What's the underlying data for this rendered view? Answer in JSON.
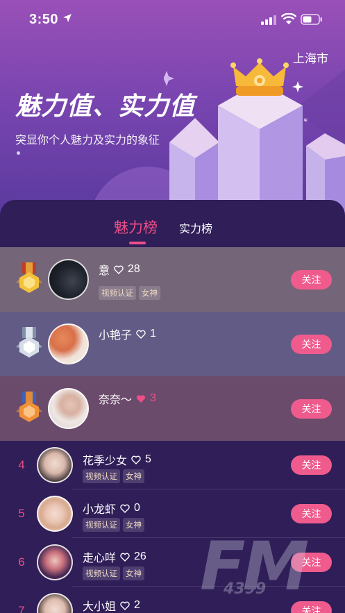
{
  "status": {
    "time": "3:50"
  },
  "header": {
    "city": "上海市",
    "title": "魅力值、实力值",
    "subtitle": "突显你个人魅力及实力的象征"
  },
  "tabs": [
    {
      "label": "魅力榜",
      "active": true
    },
    {
      "label": "实力榜",
      "active": false
    }
  ],
  "top3": [
    {
      "rank": 1,
      "medal": "gold-medal-icon",
      "name": "意",
      "likes": "28",
      "tags": [
        "视频认证",
        "女神"
      ],
      "follow": "关注"
    },
    {
      "rank": 2,
      "medal": "silver-medal-icon",
      "name": "小艳子",
      "likes": "1",
      "tags": [],
      "follow": "关注"
    },
    {
      "rank": 3,
      "medal": "bronze-medal-icon",
      "name": "奈奈～",
      "likes": "3",
      "tags": [],
      "follow": "关注"
    }
  ],
  "list": [
    {
      "rank": "4",
      "name": "花季少女",
      "likes": "5",
      "tags": [
        "视频认证",
        "女神"
      ],
      "follow": "关注"
    },
    {
      "rank": "5",
      "name": "小龙虾",
      "likes": "0",
      "tags": [
        "视频认证",
        "女神"
      ],
      "follow": "关注"
    },
    {
      "rank": "6",
      "name": "走心咩",
      "likes": "26",
      "tags": [
        "视频认证",
        "女神"
      ],
      "follow": "关注"
    },
    {
      "rank": "7",
      "name": "大小姐",
      "likes": "2",
      "tags": [],
      "follow": "关注"
    }
  ],
  "watermark": {
    "brand": "FM",
    "sub": "4399"
  },
  "colors": {
    "accent": "#ec4f86",
    "follow": "#ef5b8d",
    "panel": "#2f1e58",
    "row1": "#756579",
    "row2": "#615b85",
    "row3": "#6b4b6c"
  }
}
